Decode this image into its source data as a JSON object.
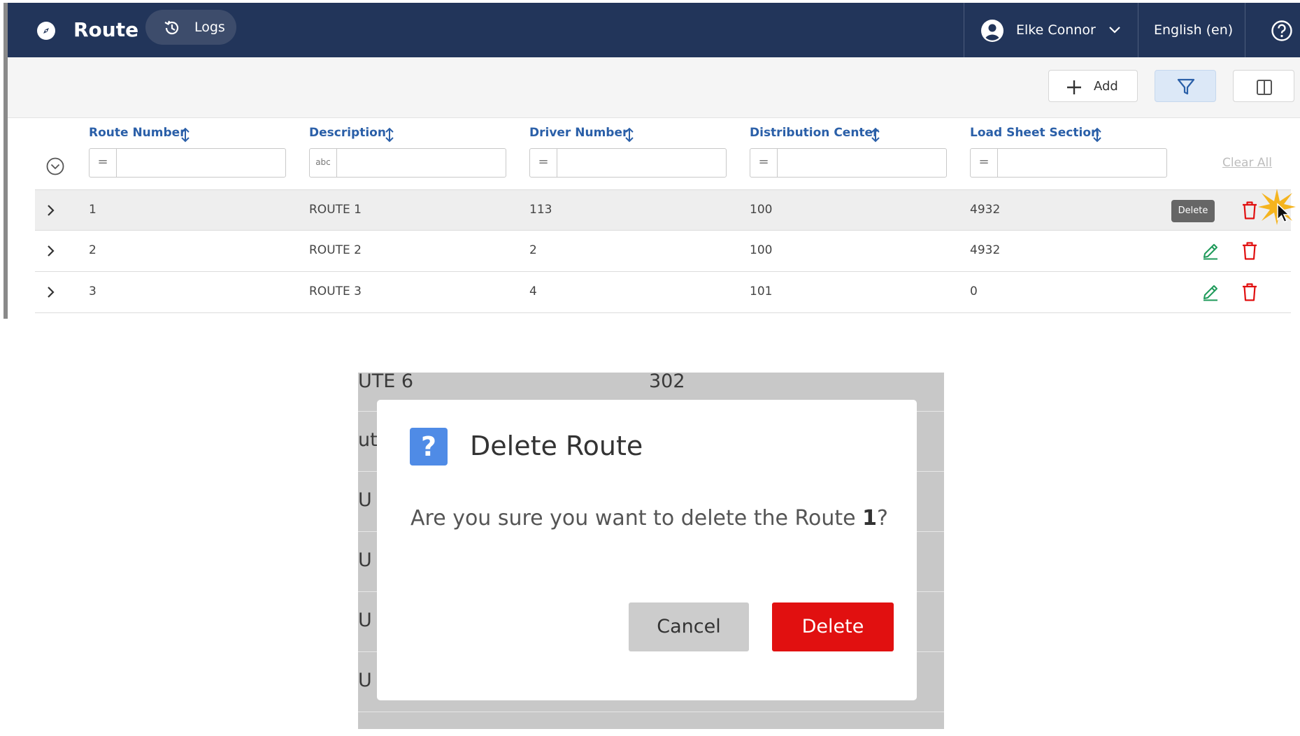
{
  "header": {
    "title": "Route",
    "logs_label": "Logs",
    "user_name": "Elke Connor",
    "language": "English (en)"
  },
  "toolbar": {
    "add_label": "Add"
  },
  "columns": [
    {
      "label": "Route Number",
      "filter_op": "="
    },
    {
      "label": "Description",
      "filter_op": "abc"
    },
    {
      "label": "Driver Number",
      "filter_op": "="
    },
    {
      "label": "Distribution Center",
      "filter_op": "="
    },
    {
      "label": "Load Sheet Section",
      "filter_op": "="
    }
  ],
  "clear_all_label": "Clear All",
  "rows": [
    {
      "route_number": "1",
      "description": "ROUTE 1",
      "driver_number": "113",
      "distribution_center": "100",
      "load_sheet_section": "4932"
    },
    {
      "route_number": "2",
      "description": "ROUTE 2",
      "driver_number": "2",
      "distribution_center": "100",
      "load_sheet_section": "4932"
    },
    {
      "route_number": "3",
      "description": "ROUTE 3",
      "driver_number": "4",
      "distribution_center": "101",
      "load_sheet_section": "0"
    }
  ],
  "tooltip": "Delete",
  "dialog": {
    "background_rows": [
      {
        "text": "UTE 6",
        "value": "302"
      },
      {
        "text": "ut"
      },
      {
        "text": "U"
      },
      {
        "text": "U"
      },
      {
        "text": "U"
      },
      {
        "text": "U"
      }
    ],
    "title": "Delete Route",
    "message_prefix": "Are you sure you want to delete the Route ",
    "message_target": "1",
    "message_suffix": "?",
    "cancel_label": "Cancel",
    "delete_label": "Delete"
  },
  "colors": {
    "header_bg": "#22355a",
    "accent_blue": "#2a5fa8",
    "delete_red": "#e11010",
    "edit_green": "#1e9a5a"
  }
}
